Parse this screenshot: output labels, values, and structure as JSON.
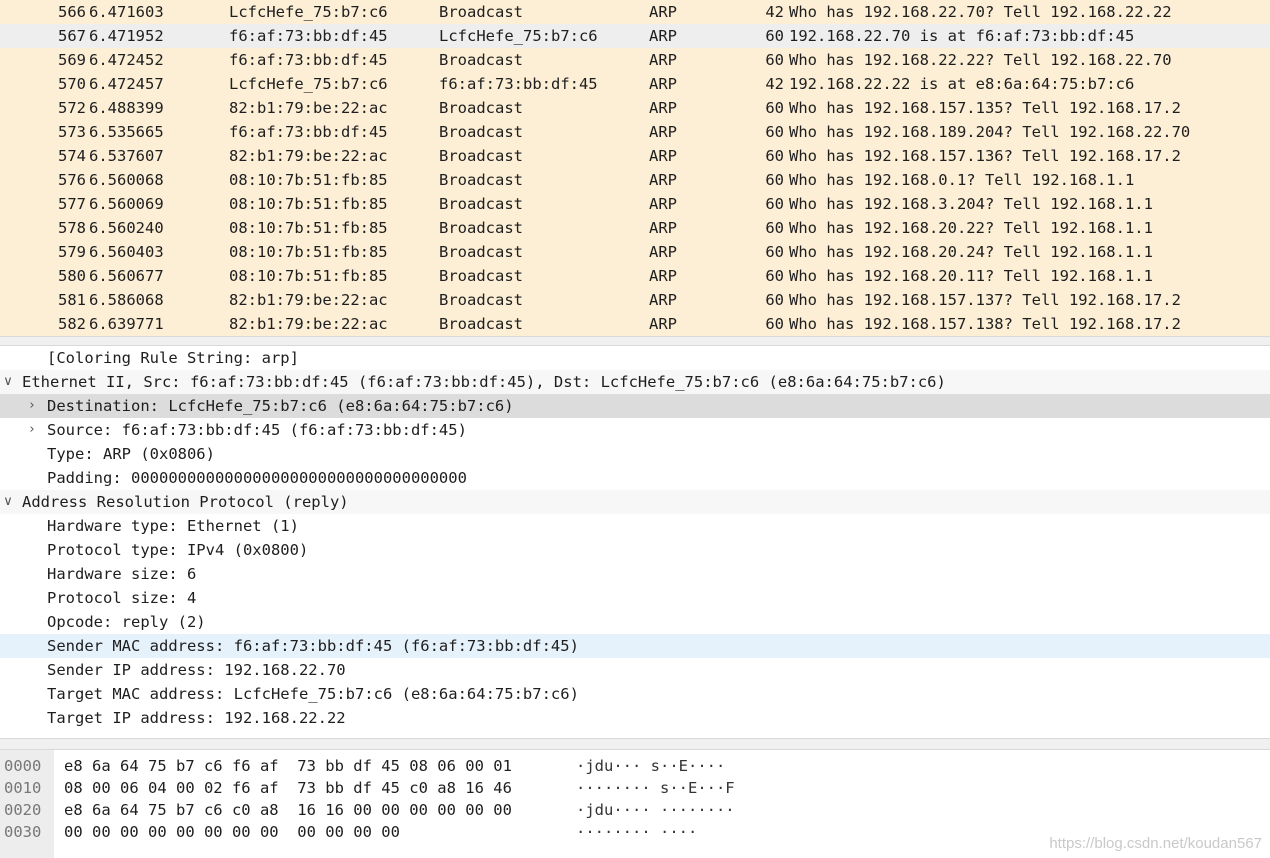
{
  "packets": [
    {
      "no": "566",
      "time": "6.471603",
      "src": "LcfcHefe_75:b7:c6",
      "dst": "Broadcast",
      "proto": "ARP",
      "len": "42",
      "info": "Who has 192.168.22.70? Tell 192.168.22.22"
    },
    {
      "no": "567",
      "time": "6.471952",
      "src": "f6:af:73:bb:df:45",
      "dst": "LcfcHefe_75:b7:c6",
      "proto": "ARP",
      "len": "60",
      "info": "192.168.22.70 is at f6:af:73:bb:df:45"
    },
    {
      "no": "569",
      "time": "6.472452",
      "src": "f6:af:73:bb:df:45",
      "dst": "Broadcast",
      "proto": "ARP",
      "len": "60",
      "info": "Who has 192.168.22.22? Tell 192.168.22.70"
    },
    {
      "no": "570",
      "time": "6.472457",
      "src": "LcfcHefe_75:b7:c6",
      "dst": "f6:af:73:bb:df:45",
      "proto": "ARP",
      "len": "42",
      "info": "192.168.22.22 is at e8:6a:64:75:b7:c6"
    },
    {
      "no": "572",
      "time": "6.488399",
      "src": "82:b1:79:be:22:ac",
      "dst": "Broadcast",
      "proto": "ARP",
      "len": "60",
      "info": "Who has 192.168.157.135? Tell 192.168.17.2"
    },
    {
      "no": "573",
      "time": "6.535665",
      "src": "f6:af:73:bb:df:45",
      "dst": "Broadcast",
      "proto": "ARP",
      "len": "60",
      "info": "Who has 192.168.189.204? Tell 192.168.22.70"
    },
    {
      "no": "574",
      "time": "6.537607",
      "src": "82:b1:79:be:22:ac",
      "dst": "Broadcast",
      "proto": "ARP",
      "len": "60",
      "info": "Who has 192.168.157.136? Tell 192.168.17.2"
    },
    {
      "no": "576",
      "time": "6.560068",
      "src": "08:10:7b:51:fb:85",
      "dst": "Broadcast",
      "proto": "ARP",
      "len": "60",
      "info": "Who has 192.168.0.1? Tell 192.168.1.1"
    },
    {
      "no": "577",
      "time": "6.560069",
      "src": "08:10:7b:51:fb:85",
      "dst": "Broadcast",
      "proto": "ARP",
      "len": "60",
      "info": "Who has 192.168.3.204? Tell 192.168.1.1"
    },
    {
      "no": "578",
      "time": "6.560240",
      "src": "08:10:7b:51:fb:85",
      "dst": "Broadcast",
      "proto": "ARP",
      "len": "60",
      "info": "Who has 192.168.20.22? Tell 192.168.1.1"
    },
    {
      "no": "579",
      "time": "6.560403",
      "src": "08:10:7b:51:fb:85",
      "dst": "Broadcast",
      "proto": "ARP",
      "len": "60",
      "info": "Who has 192.168.20.24? Tell 192.168.1.1"
    },
    {
      "no": "580",
      "time": "6.560677",
      "src": "08:10:7b:51:fb:85",
      "dst": "Broadcast",
      "proto": "ARP",
      "len": "60",
      "info": "Who has 192.168.20.11? Tell 192.168.1.1"
    },
    {
      "no": "581",
      "time": "6.586068",
      "src": "82:b1:79:be:22:ac",
      "dst": "Broadcast",
      "proto": "ARP",
      "len": "60",
      "info": "Who has 192.168.157.137? Tell 192.168.17.2"
    },
    {
      "no": "582",
      "time": "6.639771",
      "src": "82:b1:79:be:22:ac",
      "dst": "Broadcast",
      "proto": "ARP",
      "len": "60",
      "info": "Who has 192.168.157.138? Tell 192.168.17.2"
    }
  ],
  "details": [
    {
      "level": 1,
      "arrow": "",
      "text": "[Coloring Rule String: arp]"
    },
    {
      "level": 0,
      "arrow": "expanded",
      "text": "Ethernet II, Src: f6:af:73:bb:df:45 (f6:af:73:bb:df:45), Dst: LcfcHefe_75:b7:c6 (e8:6a:64:75:b7:c6)"
    },
    {
      "level": 1,
      "arrow": "collapsed",
      "text": "Destination: LcfcHefe_75:b7:c6 (e8:6a:64:75:b7:c6)",
      "highlight": "gray"
    },
    {
      "level": 1,
      "arrow": "collapsed",
      "text": "Source: f6:af:73:bb:df:45 (f6:af:73:bb:df:45)"
    },
    {
      "level": 1,
      "arrow": "",
      "text": "Type: ARP (0x0806)"
    },
    {
      "level": 1,
      "arrow": "",
      "text": "Padding: 000000000000000000000000000000000000"
    },
    {
      "level": 0,
      "arrow": "expanded",
      "text": "Address Resolution Protocol (reply)"
    },
    {
      "level": 1,
      "arrow": "",
      "text": "Hardware type: Ethernet (1)"
    },
    {
      "level": 1,
      "arrow": "",
      "text": "Protocol type: IPv4 (0x0800)"
    },
    {
      "level": 1,
      "arrow": "",
      "text": "Hardware size: 6"
    },
    {
      "level": 1,
      "arrow": "",
      "text": "Protocol size: 4"
    },
    {
      "level": 1,
      "arrow": "",
      "text": "Opcode: reply (2)"
    },
    {
      "level": 1,
      "arrow": "",
      "text": "Sender MAC address: f6:af:73:bb:df:45 (f6:af:73:bb:df:45)",
      "highlight": "blue"
    },
    {
      "level": 1,
      "arrow": "",
      "text": "Sender IP address: 192.168.22.70"
    },
    {
      "level": 1,
      "arrow": "",
      "text": "Target MAC address: LcfcHefe_75:b7:c6 (e8:6a:64:75:b7:c6)"
    },
    {
      "level": 1,
      "arrow": "",
      "text": "Target IP address: 192.168.22.22"
    }
  ],
  "hex": [
    {
      "offset": "0000",
      "bytes": "e8 6a 64 75 b7 c6 f6 af  73 bb df 45 08 06 00 01",
      "ascii": "·jdu··· s··E····"
    },
    {
      "offset": "0010",
      "bytes": "08 00 06 04 00 02 f6 af  73 bb df 45 c0 a8 16 46",
      "ascii": "········ s··E···F"
    },
    {
      "offset": "0020",
      "bytes": "e8 6a 64 75 b7 c6 c0 a8  16 16 00 00 00 00 00 00",
      "ascii": "·jdu···· ········"
    },
    {
      "offset": "0030",
      "bytes": "00 00 00 00 00 00 00 00  00 00 00 00",
      "ascii": "········ ····"
    }
  ],
  "watermark": "https://blog.csdn.net/koudan567",
  "colors": {
    "arp_row": "#fcefd6",
    "selected_row": "#eeeeee",
    "detail_gray_selection": "#dcdcdc",
    "detail_blue_hover": "#e5f1fb"
  }
}
